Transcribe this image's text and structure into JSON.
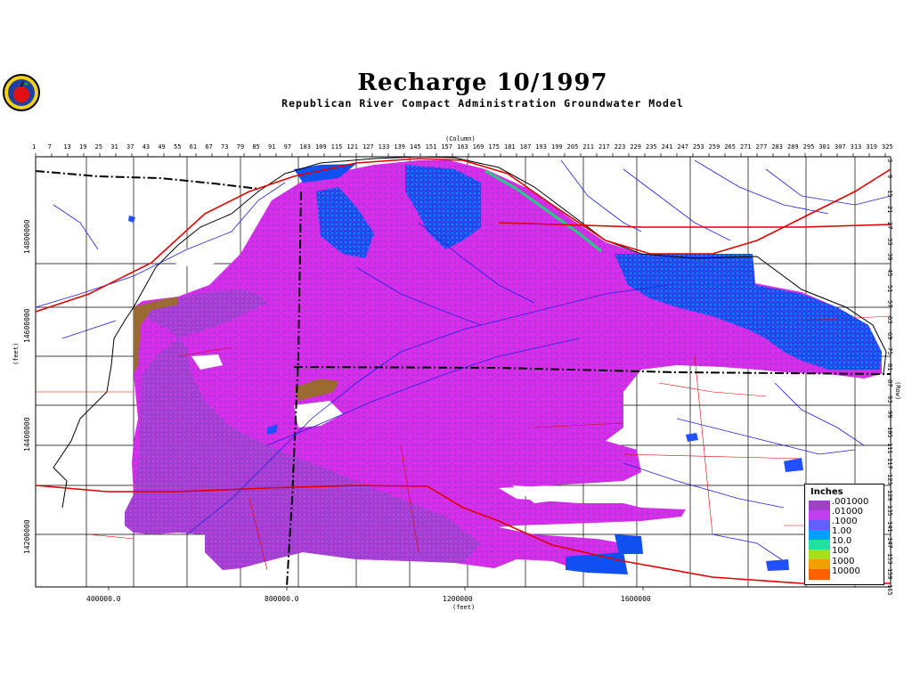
{
  "title": "Recharge  10/1997",
  "subtitle": "Republican River Compact Administration Groundwater Model",
  "axis": {
    "column_label": "(Column)",
    "row_label": "(Row)",
    "feet_label_x": "(feet)",
    "feet_label_y": "(feet)",
    "column_ticks": [
      "1",
      "7",
      "13",
      "19",
      "25",
      "31",
      "37",
      "43",
      "49",
      "55",
      "61",
      "67",
      "73",
      "79",
      "85",
      "91",
      "97",
      "103",
      "109",
      "115",
      "121",
      "127",
      "133",
      "139",
      "145",
      "151",
      "157",
      "163",
      "169",
      "175",
      "181",
      "187",
      "193",
      "199",
      "205",
      "211",
      "217",
      "223",
      "229",
      "235",
      "241",
      "247",
      "253",
      "259",
      "265",
      "271",
      "277",
      "283",
      "289",
      "295",
      "301",
      "307",
      "313",
      "319",
      "325"
    ],
    "row_ticks": [
      "3",
      "9",
      "15",
      "21",
      "27",
      "33",
      "39",
      "45",
      "51",
      "57",
      "63",
      "69",
      "75",
      "81",
      "87",
      "93",
      "99",
      "105",
      "111",
      "117",
      "123",
      "129",
      "135",
      "141",
      "147",
      "153",
      "159",
      "165"
    ],
    "x_ticks": [
      "400000.0",
      "800000.0",
      "1200000",
      "1600000"
    ],
    "y_ticks": [
      "14800000",
      "14600000",
      "14400000",
      "14200000"
    ]
  },
  "legend": {
    "title": "Inches",
    "entries": [
      ".001000",
      ".01000",
      ".1000",
      "1.00",
      "10.0",
      "100",
      "1000",
      "10000"
    ],
    "colors": [
      "#a040c8",
      "#c040f0",
      "#6060ff",
      "#00a0ff",
      "#20e0a0",
      "#a0e020",
      "#f0a000",
      "#ff6000"
    ]
  },
  "colors": {
    "recharge_low": "#c040e0",
    "recharge_magenta": "#e020f0",
    "recharge_blue": "#1050f0",
    "rivers": "#2020e0",
    "roads": "#e00000",
    "boundaries": "#000000"
  },
  "logo": {
    "icon": "apple-seal-icon"
  }
}
